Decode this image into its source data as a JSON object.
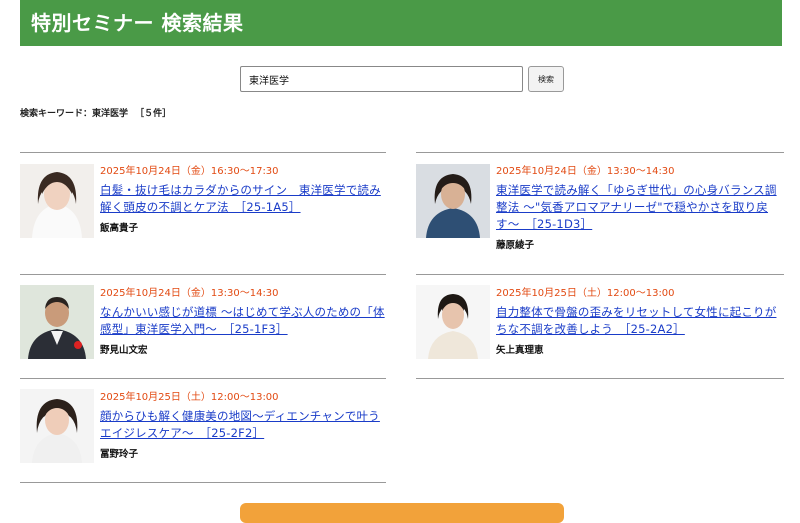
{
  "header": {
    "title": "特別セミナー 検索結果"
  },
  "search": {
    "value": "東洋医学",
    "button_label": "検索"
  },
  "keyword_summary": {
    "label": "検索キーワード：東洋医学",
    "count": "［５件］"
  },
  "colors": {
    "header_bg": "#4a9a47",
    "date": "#e24a12",
    "link": "#1a3cc8",
    "button": "#f2a23a"
  },
  "seminars_left": [
    {
      "date": "2025年10月24日（金）16:30～17:30",
      "title": "白髪・抜け毛はカラダからのサイン　東洋医学で読み解く頭皮の不調とケア法　［25-1A5］",
      "speaker": "飯高貴子"
    },
    {
      "date": "2025年10月24日（金）13:30～14:30",
      "title": "なんかいい感じが道標 〜はじめて学ぶ人のための「体感型」東洋医学入門〜　［25-1F3］",
      "speaker": "野見山文宏"
    },
    {
      "date": "2025年10月25日（土）12:00～13:00",
      "title": "顔からひも解く健康美の地図〜ディエンチャンで叶うエイジレスケア〜　［25-2F2］",
      "speaker": "冨野玲子"
    }
  ],
  "seminars_right": [
    {
      "date": "2025年10月24日（金）13:30～14:30",
      "title": "東洋医学で読み解く「ゆらぎ世代」の心身バランス調整法 〜\"気香アロマアナリーゼ\"で穏やかさを取り戻す〜　［25-1D3］",
      "speaker": "藤原綾子"
    },
    {
      "date": "2025年10月25日（土）12:00～13:00",
      "title": "自力整体で骨盤の歪みをリセットして女性に起こりがちな不調を改善しよう　［25-2A2］",
      "speaker": "矢上真理恵"
    }
  ]
}
